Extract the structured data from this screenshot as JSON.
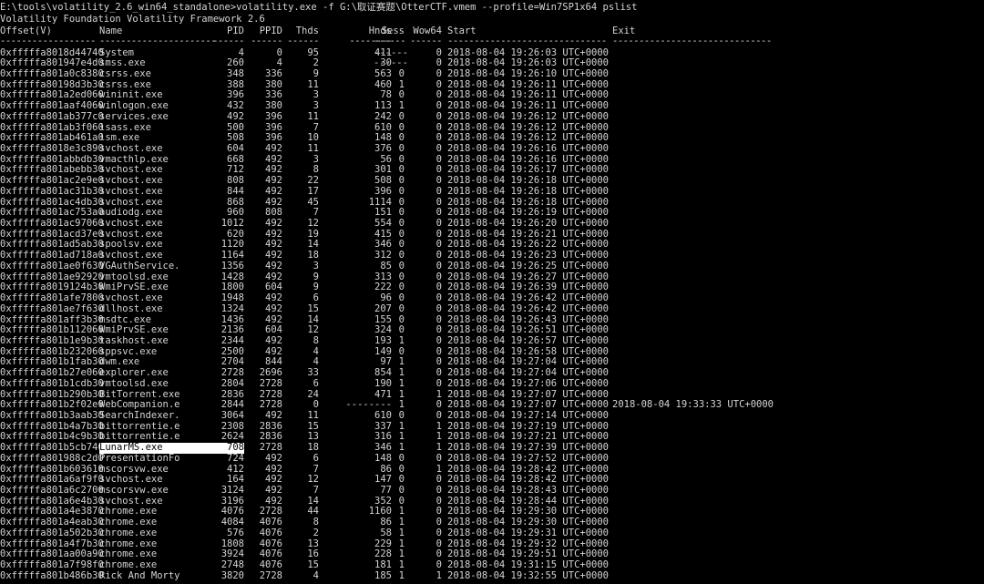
{
  "terminal": {
    "command_line": "E:\\tools\\volatility_2.6_win64_standalone>volatility.exe -f G:\\取证赛题\\OtterCTF.vmem --profile=Win7SP1x64 pslist",
    "banner": "Volatility Foundation Volatility Framework 2.6",
    "colors": {
      "background": "#000000",
      "text": "#d4d4d4",
      "highlight_bg": "#ffffff",
      "highlight_text": "#000000"
    }
  },
  "table": {
    "columns": [
      "Offset(V)",
      "Name",
      "PID",
      "PPID",
      "Thds",
      "Hnds",
      "Sess",
      "Wow64",
      "Start",
      "Exit"
    ],
    "separators": [
      "------------------",
      "----------------------",
      "------",
      "------",
      "------",
      "--------",
      "------",
      "------",
      "------------------------------",
      "------------------------------"
    ],
    "rows": [
      {
        "offset": "0xfffffa8018d44740",
        "name": "System",
        "pid": "4",
        "ppid": "0",
        "thds": "95",
        "hnds": "411",
        "sess": "------",
        "wow": "0",
        "start": "2018-08-04 19:26:03 UTC+0000",
        "exit": ""
      },
      {
        "offset": "0xfffffa801947e4d0",
        "name": "smss.exe",
        "pid": "260",
        "ppid": "4",
        "thds": "2",
        "hnds": "30",
        "sess": "------",
        "wow": "0",
        "start": "2018-08-04 19:26:03 UTC+0000",
        "exit": ""
      },
      {
        "offset": "0xfffffa801a0c8380",
        "name": "csrss.exe",
        "pid": "348",
        "ppid": "336",
        "thds": "9",
        "hnds": "563",
        "sess": "0",
        "wow": "0",
        "start": "2018-08-04 19:26:10 UTC+0000",
        "exit": ""
      },
      {
        "offset": "0xfffffa80198d3b30",
        "name": "csrss.exe",
        "pid": "388",
        "ppid": "380",
        "thds": "11",
        "hnds": "460",
        "sess": "1",
        "wow": "0",
        "start": "2018-08-04 19:26:11 UTC+0000",
        "exit": ""
      },
      {
        "offset": "0xfffffa801a2ed060",
        "name": "wininit.exe",
        "pid": "396",
        "ppid": "336",
        "thds": "3",
        "hnds": "78",
        "sess": "0",
        "wow": "0",
        "start": "2018-08-04 19:26:11 UTC+0000",
        "exit": ""
      },
      {
        "offset": "0xfffffa801aaf4060",
        "name": "winlogon.exe",
        "pid": "432",
        "ppid": "380",
        "thds": "3",
        "hnds": "113",
        "sess": "1",
        "wow": "0",
        "start": "2018-08-04 19:26:11 UTC+0000",
        "exit": ""
      },
      {
        "offset": "0xfffffa801ab377c0",
        "name": "services.exe",
        "pid": "492",
        "ppid": "396",
        "thds": "11",
        "hnds": "242",
        "sess": "0",
        "wow": "0",
        "start": "2018-08-04 19:26:12 UTC+0000",
        "exit": ""
      },
      {
        "offset": "0xfffffa801ab3f060",
        "name": "lsass.exe",
        "pid": "500",
        "ppid": "396",
        "thds": "7",
        "hnds": "610",
        "sess": "0",
        "wow": "0",
        "start": "2018-08-04 19:26:12 UTC+0000",
        "exit": ""
      },
      {
        "offset": "0xfffffa801ab461a0",
        "name": "lsm.exe",
        "pid": "508",
        "ppid": "396",
        "thds": "10",
        "hnds": "148",
        "sess": "0",
        "wow": "0",
        "start": "2018-08-04 19:26:12 UTC+0000",
        "exit": ""
      },
      {
        "offset": "0xfffffa8018e3c890",
        "name": "svchost.exe",
        "pid": "604",
        "ppid": "492",
        "thds": "11",
        "hnds": "376",
        "sess": "0",
        "wow": "0",
        "start": "2018-08-04 19:26:16 UTC+0000",
        "exit": ""
      },
      {
        "offset": "0xfffffa801abbdb30",
        "name": "vmacthlp.exe",
        "pid": "668",
        "ppid": "492",
        "thds": "3",
        "hnds": "56",
        "sess": "0",
        "wow": "0",
        "start": "2018-08-04 19:26:16 UTC+0000",
        "exit": ""
      },
      {
        "offset": "0xfffffa801abebb30",
        "name": "svchost.exe",
        "pid": "712",
        "ppid": "492",
        "thds": "8",
        "hnds": "301",
        "sess": "0",
        "wow": "0",
        "start": "2018-08-04 19:26:17 UTC+0000",
        "exit": ""
      },
      {
        "offset": "0xfffffa801ac2e9e0",
        "name": "svchost.exe",
        "pid": "808",
        "ppid": "492",
        "thds": "22",
        "hnds": "508",
        "sess": "0",
        "wow": "0",
        "start": "2018-08-04 19:26:18 UTC+0000",
        "exit": ""
      },
      {
        "offset": "0xfffffa801ac31b30",
        "name": "svchost.exe",
        "pid": "844",
        "ppid": "492",
        "thds": "17",
        "hnds": "396",
        "sess": "0",
        "wow": "0",
        "start": "2018-08-04 19:26:18 UTC+0000",
        "exit": ""
      },
      {
        "offset": "0xfffffa801ac4db30",
        "name": "svchost.exe",
        "pid": "868",
        "ppid": "492",
        "thds": "45",
        "hnds": "1114",
        "sess": "0",
        "wow": "0",
        "start": "2018-08-04 19:26:18 UTC+0000",
        "exit": ""
      },
      {
        "offset": "0xfffffa801ac753a0",
        "name": "audiodg.exe",
        "pid": "960",
        "ppid": "808",
        "thds": "7",
        "hnds": "151",
        "sess": "0",
        "wow": "0",
        "start": "2018-08-04 19:26:19 UTC+0000",
        "exit": ""
      },
      {
        "offset": "0xfffffa801ac97060",
        "name": "svchost.exe",
        "pid": "1012",
        "ppid": "492",
        "thds": "12",
        "hnds": "554",
        "sess": "0",
        "wow": "0",
        "start": "2018-08-04 19:26:20 UTC+0000",
        "exit": ""
      },
      {
        "offset": "0xfffffa801acd37e0",
        "name": "svchost.exe",
        "pid": "620",
        "ppid": "492",
        "thds": "19",
        "hnds": "415",
        "sess": "0",
        "wow": "0",
        "start": "2018-08-04 19:26:21 UTC+0000",
        "exit": ""
      },
      {
        "offset": "0xfffffa801ad5ab30",
        "name": "spoolsv.exe",
        "pid": "1120",
        "ppid": "492",
        "thds": "14",
        "hnds": "346",
        "sess": "0",
        "wow": "0",
        "start": "2018-08-04 19:26:22 UTC+0000",
        "exit": ""
      },
      {
        "offset": "0xfffffa801ad718a0",
        "name": "svchost.exe",
        "pid": "1164",
        "ppid": "492",
        "thds": "18",
        "hnds": "312",
        "sess": "0",
        "wow": "0",
        "start": "2018-08-04 19:26:23 UTC+0000",
        "exit": ""
      },
      {
        "offset": "0xfffffa801ae0f630",
        "name": "VGAuthService.",
        "pid": "1356",
        "ppid": "492",
        "thds": "3",
        "hnds": "85",
        "sess": "0",
        "wow": "0",
        "start": "2018-08-04 19:26:25 UTC+0000",
        "exit": ""
      },
      {
        "offset": "0xfffffa801ae92920",
        "name": "vmtoolsd.exe",
        "pid": "1428",
        "ppid": "492",
        "thds": "9",
        "hnds": "313",
        "sess": "0",
        "wow": "0",
        "start": "2018-08-04 19:26:27 UTC+0000",
        "exit": ""
      },
      {
        "offset": "0xfffffa8019124b30",
        "name": "WmiPrvSE.exe",
        "pid": "1800",
        "ppid": "604",
        "thds": "9",
        "hnds": "222",
        "sess": "0",
        "wow": "0",
        "start": "2018-08-04 19:26:39 UTC+0000",
        "exit": ""
      },
      {
        "offset": "0xfffffa801afe7800",
        "name": "svchost.exe",
        "pid": "1948",
        "ppid": "492",
        "thds": "6",
        "hnds": "96",
        "sess": "0",
        "wow": "0",
        "start": "2018-08-04 19:26:42 UTC+0000",
        "exit": ""
      },
      {
        "offset": "0xfffffa801ae7f630",
        "name": "dllhost.exe",
        "pid": "1324",
        "ppid": "492",
        "thds": "15",
        "hnds": "207",
        "sess": "0",
        "wow": "0",
        "start": "2018-08-04 19:26:42 UTC+0000",
        "exit": ""
      },
      {
        "offset": "0xfffffa801aff3b30",
        "name": "msdtc.exe",
        "pid": "1436",
        "ppid": "492",
        "thds": "14",
        "hnds": "155",
        "sess": "0",
        "wow": "0",
        "start": "2018-08-04 19:26:43 UTC+0000",
        "exit": ""
      },
      {
        "offset": "0xfffffa801b112060",
        "name": "WmiPrvSE.exe",
        "pid": "2136",
        "ppid": "604",
        "thds": "12",
        "hnds": "324",
        "sess": "0",
        "wow": "0",
        "start": "2018-08-04 19:26:51 UTC+0000",
        "exit": ""
      },
      {
        "offset": "0xfffffa801b1e9b30",
        "name": "taskhost.exe",
        "pid": "2344",
        "ppid": "492",
        "thds": "8",
        "hnds": "193",
        "sess": "1",
        "wow": "0",
        "start": "2018-08-04 19:26:57 UTC+0000",
        "exit": ""
      },
      {
        "offset": "0xfffffa801b232060",
        "name": "sppsvc.exe",
        "pid": "2500",
        "ppid": "492",
        "thds": "4",
        "hnds": "149",
        "sess": "0",
        "wow": "0",
        "start": "2018-08-04 19:26:58 UTC+0000",
        "exit": ""
      },
      {
        "offset": "0xfffffa801b1fab30",
        "name": "dwm.exe",
        "pid": "2704",
        "ppid": "844",
        "thds": "4",
        "hnds": "97",
        "sess": "1",
        "wow": "0",
        "start": "2018-08-04 19:27:04 UTC+0000",
        "exit": ""
      },
      {
        "offset": "0xfffffa801b27e060",
        "name": "explorer.exe",
        "pid": "2728",
        "ppid": "2696",
        "thds": "33",
        "hnds": "854",
        "sess": "1",
        "wow": "0",
        "start": "2018-08-04 19:27:04 UTC+0000",
        "exit": ""
      },
      {
        "offset": "0xfffffa801b1cdb30",
        "name": "vmtoolsd.exe",
        "pid": "2804",
        "ppid": "2728",
        "thds": "6",
        "hnds": "190",
        "sess": "1",
        "wow": "0",
        "start": "2018-08-04 19:27:06 UTC+0000",
        "exit": ""
      },
      {
        "offset": "0xfffffa801b290b30",
        "name": "BitTorrent.exe",
        "pid": "2836",
        "ppid": "2728",
        "thds": "24",
        "hnds": "471",
        "sess": "1",
        "wow": "1",
        "start": "2018-08-04 19:27:07 UTC+0000",
        "exit": ""
      },
      {
        "offset": "0xfffffa801b2f02e0",
        "name": "WebCompanion.e",
        "pid": "2844",
        "ppid": "2728",
        "thds": "0",
        "hnds": "--------",
        "sess": "1",
        "wow": "0",
        "start": "2018-08-04 19:27:07 UTC+0000",
        "exit": "2018-08-04 19:33:33 UTC+0000"
      },
      {
        "offset": "0xfffffa801b3aab30",
        "name": "SearchIndexer.",
        "pid": "3064",
        "ppid": "492",
        "thds": "11",
        "hnds": "610",
        "sess": "0",
        "wow": "0",
        "start": "2018-08-04 19:27:14 UTC+0000",
        "exit": ""
      },
      {
        "offset": "0xfffffa801b4a7b30",
        "name": "bittorrentie.e",
        "pid": "2308",
        "ppid": "2836",
        "thds": "15",
        "hnds": "337",
        "sess": "1",
        "wow": "1",
        "start": "2018-08-04 19:27:19 UTC+0000",
        "exit": ""
      },
      {
        "offset": "0xfffffa801b4c9b30",
        "name": "bittorrentie.e",
        "pid": "2624",
        "ppid": "2836",
        "thds": "13",
        "hnds": "316",
        "sess": "1",
        "wow": "1",
        "start": "2018-08-04 19:27:21 UTC+0000",
        "exit": ""
      },
      {
        "offset": "0xfffffa801b5cb740",
        "name": "LunarMS.exe",
        "pid": "708",
        "ppid": "2728",
        "thds": "18",
        "hnds": "346",
        "sess": "1",
        "wow": "1",
        "start": "2018-08-04 19:27:39 UTC+0000",
        "exit": "",
        "selected": true
      },
      {
        "offset": "0xfffffa801988c2d0",
        "name": "PresentationFo",
        "pid": "724",
        "ppid": "492",
        "thds": "6",
        "hnds": "148",
        "sess": "0",
        "wow": "0",
        "start": "2018-08-04 19:27:52 UTC+0000",
        "exit": ""
      },
      {
        "offset": "0xfffffa801b603610",
        "name": "mscorsvw.exe",
        "pid": "412",
        "ppid": "492",
        "thds": "7",
        "hnds": "86",
        "sess": "0",
        "wow": "1",
        "start": "2018-08-04 19:28:42 UTC+0000",
        "exit": ""
      },
      {
        "offset": "0xfffffa801a6af9f0",
        "name": "svchost.exe",
        "pid": "164",
        "ppid": "492",
        "thds": "12",
        "hnds": "147",
        "sess": "0",
        "wow": "0",
        "start": "2018-08-04 19:28:42 UTC+0000",
        "exit": ""
      },
      {
        "offset": "0xfffffa801a6c2700",
        "name": "mscorsvw.exe",
        "pid": "3124",
        "ppid": "492",
        "thds": "7",
        "hnds": "77",
        "sess": "0",
        "wow": "0",
        "start": "2018-08-04 19:28:43 UTC+0000",
        "exit": ""
      },
      {
        "offset": "0xfffffa801a6e4b30",
        "name": "svchost.exe",
        "pid": "3196",
        "ppid": "492",
        "thds": "14",
        "hnds": "352",
        "sess": "0",
        "wow": "0",
        "start": "2018-08-04 19:28:44 UTC+0000",
        "exit": ""
      },
      {
        "offset": "0xfffffa801a4e3870",
        "name": "chrome.exe",
        "pid": "4076",
        "ppid": "2728",
        "thds": "44",
        "hnds": "1160",
        "sess": "1",
        "wow": "0",
        "start": "2018-08-04 19:29:30 UTC+0000",
        "exit": ""
      },
      {
        "offset": "0xfffffa801a4eab30",
        "name": "chrome.exe",
        "pid": "4084",
        "ppid": "4076",
        "thds": "8",
        "hnds": "86",
        "sess": "1",
        "wow": "0",
        "start": "2018-08-04 19:29:30 UTC+0000",
        "exit": ""
      },
      {
        "offset": "0xfffffa801a502b30",
        "name": "chrome.exe",
        "pid": "576",
        "ppid": "4076",
        "thds": "2",
        "hnds": "58",
        "sess": "1",
        "wow": "0",
        "start": "2018-08-04 19:29:31 UTC+0000",
        "exit": ""
      },
      {
        "offset": "0xfffffa801a4f7b30",
        "name": "chrome.exe",
        "pid": "1808",
        "ppid": "4076",
        "thds": "13",
        "hnds": "229",
        "sess": "1",
        "wow": "0",
        "start": "2018-08-04 19:29:32 UTC+0000",
        "exit": ""
      },
      {
        "offset": "0xfffffa801aa00a90",
        "name": "chrome.exe",
        "pid": "3924",
        "ppid": "4076",
        "thds": "16",
        "hnds": "228",
        "sess": "1",
        "wow": "0",
        "start": "2018-08-04 19:29:51 UTC+0000",
        "exit": ""
      },
      {
        "offset": "0xfffffa801a7f98f0",
        "name": "chrome.exe",
        "pid": "2748",
        "ppid": "4076",
        "thds": "15",
        "hnds": "181",
        "sess": "1",
        "wow": "0",
        "start": "2018-08-04 19:31:15 UTC+0000",
        "exit": ""
      },
      {
        "offset": "0xfffffa801b486b30",
        "name": "Rick And Morty",
        "pid": "3820",
        "ppid": "2728",
        "thds": "4",
        "hnds": "185",
        "sess": "1",
        "wow": "1",
        "start": "2018-08-04 19:32:55 UTC+0000",
        "exit": ""
      }
    ]
  }
}
